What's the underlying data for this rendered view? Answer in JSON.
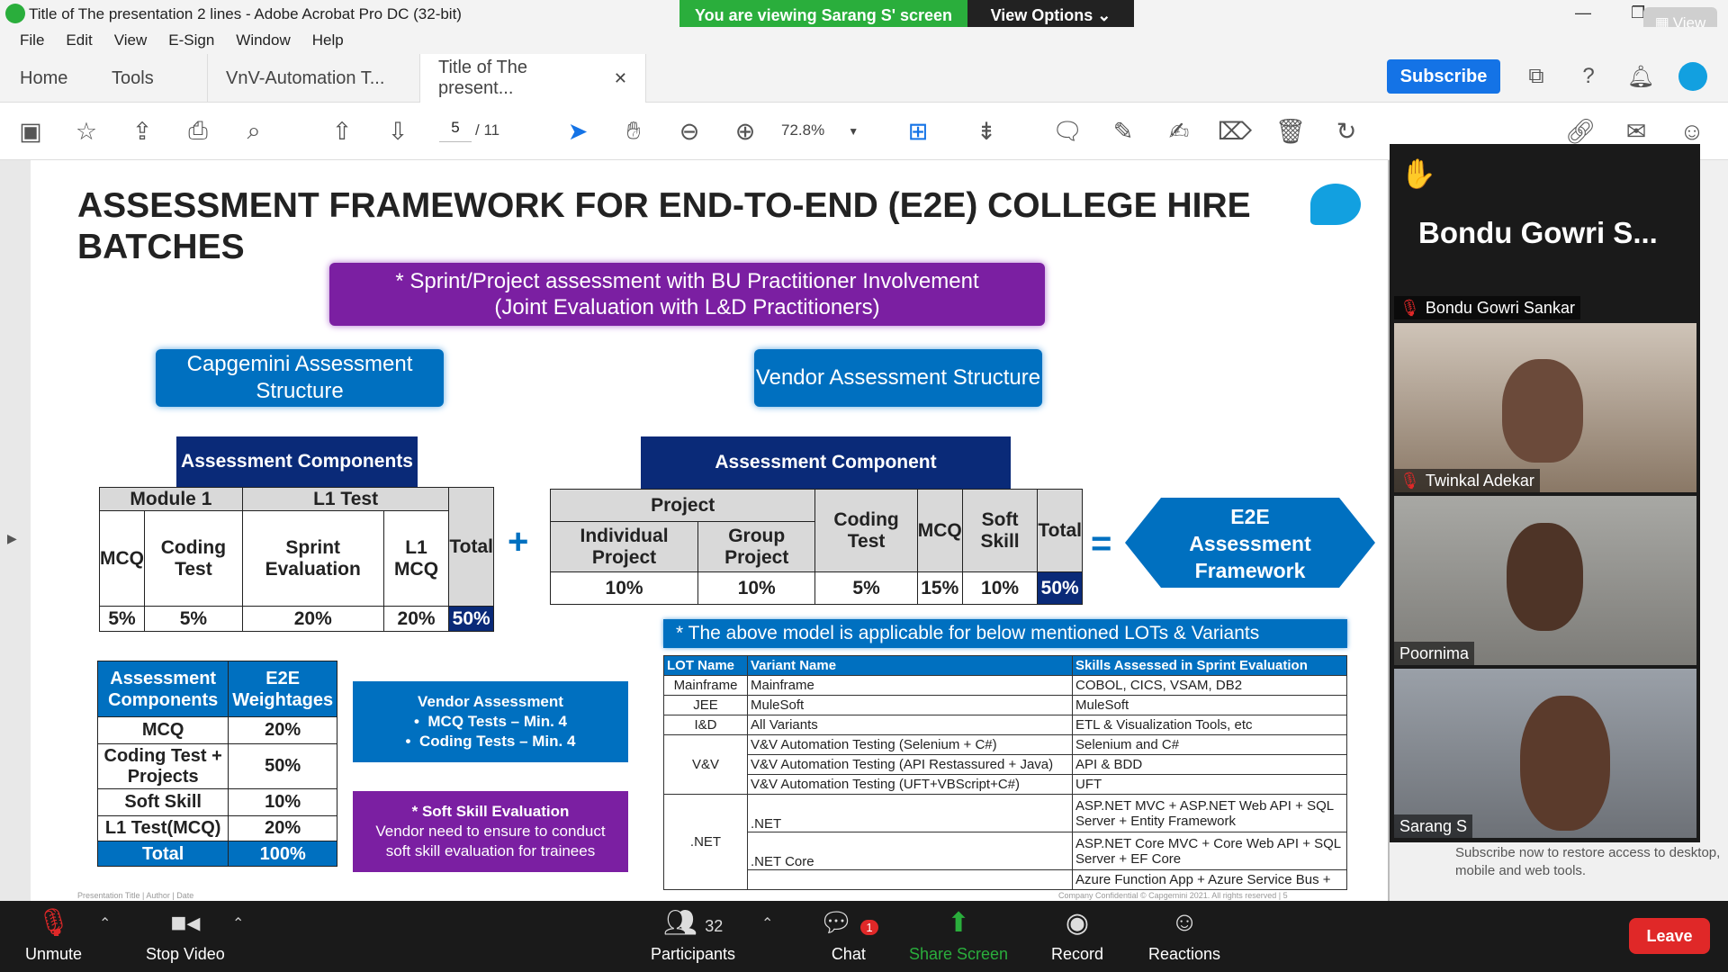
{
  "window": {
    "title": "Title of The presentation 2 lines - Adobe Acrobat Pro DC (32-bit)"
  },
  "share_banner": {
    "text": "You are viewing Sarang S' screen",
    "view_options": "View Options"
  },
  "zoom_view_button": "View",
  "menu": [
    "File",
    "Edit",
    "View",
    "E-Sign",
    "Window",
    "Help"
  ],
  "tabs": {
    "home": "Home",
    "tools": "Tools",
    "doc1": "VnV-Automation T...",
    "doc2": "Title of The present..."
  },
  "subscribe_label": "Subscribe",
  "toolbar": {
    "page_current": "5",
    "page_total": "/  11",
    "zoom": "72.8%"
  },
  "slide": {
    "title": "ASSESSMENT FRAMEWORK FOR END-TO-END (E2E) COLLEGE HIRE BATCHES",
    "sprint_line1": "* Sprint/Project assessment with BU Practitioner Involvement",
    "sprint_line2": "(Joint Evaluation with L&D Practitioners)",
    "capgemini_box": "Capgemini Assessment Structure",
    "vendor_box": "Vendor Assessment Structure",
    "left_table": {
      "header": "Assessment Components",
      "module1": "Module 1",
      "l1test": "L1 Test",
      "total": "Total",
      "cols": [
        "MCQ",
        "Coding Test",
        "Sprint Evaluation",
        "L1 MCQ"
      ],
      "values": [
        "5%",
        "5%",
        "20%",
        "20%"
      ],
      "total_value": "50%"
    },
    "plus": "+",
    "equals": "=",
    "right_table": {
      "header": "Assessment Component",
      "project": "Project",
      "cols": [
        "Individual Project",
        "Group Project",
        "Coding Test",
        "MCQ",
        "Soft Skill",
        "Total"
      ],
      "values": [
        "10%",
        "10%",
        "5%",
        "15%",
        "10%",
        "50%"
      ]
    },
    "e2e": "E2E Assessment Framework",
    "lot_banner": "* The above model is applicable for below mentioned LOTs & Variants",
    "lot_table": {
      "headers": [
        "LOT Name",
        "Variant Name",
        "Skills Assessed in Sprint Evaluation"
      ],
      "rows": [
        {
          "lot": "Mainframe",
          "variant": "Mainframe",
          "skills": "COBOL, CICS, VSAM, DB2"
        },
        {
          "lot": "JEE",
          "variant": "MuleSoft",
          "skills": "MuleSoft"
        },
        {
          "lot": "I&D",
          "variant": "All Variants",
          "skills": "ETL & Visualization Tools, etc"
        },
        {
          "lot": "V&V",
          "variant": "V&V Automation Testing (Selenium + C#)",
          "skills": "Selenium and C#"
        },
        {
          "lot": "",
          "variant": "V&V Automation Testing (API Restassured + Java)",
          "skills": "API & BDD"
        },
        {
          "lot": "",
          "variant": "V&V Automation Testing (UFT+VBScript+C#)",
          "skills": "UFT"
        },
        {
          "lot": ".NET",
          "variant": ".NET",
          "skills": "ASP.NET MVC + ASP.NET Web API + SQL Server + Entity Framework"
        },
        {
          "lot": "",
          "variant": ".NET Core",
          "skills": "ASP.NET Core MVC + Core Web API + SQL Server + EF Core"
        },
        {
          "lot": "",
          "variant": "",
          "skills": "Azure Function App + Azure Service Bus +"
        }
      ]
    },
    "weights_table": {
      "headers": [
        "Assessment Components",
        "E2E Weightages"
      ],
      "rows": [
        [
          "MCQ",
          "20%"
        ],
        [
          "Coding Test + Projects",
          "50%"
        ],
        [
          "Soft Skill",
          "10%"
        ],
        [
          "L1 Test(MCQ)",
          "20%"
        ]
      ],
      "total": [
        "Total",
        "100%"
      ]
    },
    "vendor_assessment": {
      "title": "Vendor Assessment",
      "items": [
        "MCQ Tests – Min. 4",
        "Coding Tests – Min. 4"
      ]
    },
    "soft_skill": {
      "title": "* Soft Skill Evaluation",
      "body": "Vendor need to ensure to conduct soft skill evaluation for trainees"
    },
    "footer": "Presentation Title | Author | Date",
    "confidential": "Company Confidential © Capgemini 2021. All rights reserved | 5"
  },
  "video_panel": {
    "active_speaker": "Bondu  Gowri  S...",
    "participants": [
      {
        "name": "Bondu Gowri Sankar",
        "muted": true
      },
      {
        "name": "Twinkal Adekar",
        "muted": true
      },
      {
        "name": "Poornima",
        "muted": false
      },
      {
        "name": "Sarang S",
        "muted": false
      }
    ]
  },
  "sidebar_msg": "Subscribe now to restore access to desktop, mobile and web tools.",
  "zoom_controls": {
    "unmute": "Unmute",
    "stop_video": "Stop Video",
    "participants": "Participants",
    "participants_count": "32",
    "chat": "Chat",
    "chat_badge": "1",
    "share": "Share Screen",
    "record": "Record",
    "reactions": "Reactions",
    "leave": "Leave"
  }
}
